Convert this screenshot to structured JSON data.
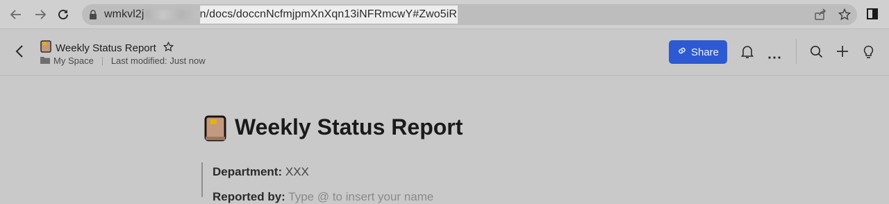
{
  "browser": {
    "url_prefix": "wmkvl2j",
    "url_domain_suffix": "n",
    "url_path": "/docs/doccnNcfmjpmXnXqn13iNFRmcwY#Zwo5iR",
    "icons": [
      "back-arrow-icon",
      "forward-arrow-icon",
      "reload-icon",
      "lock-icon",
      "share-page-icon",
      "bookmark-star-icon",
      "side-panel-icon"
    ]
  },
  "header": {
    "doc_title": "Weekly Status Report",
    "space": "My Space",
    "modified": "Last modified: Just now",
    "share_label": "Share"
  },
  "document": {
    "heading": "Weekly Status Report",
    "fields": [
      {
        "label": "Department:",
        "value": "XXX"
      },
      {
        "label": "Reported by:",
        "value": "Type @ to insert your name"
      }
    ]
  },
  "colors": {
    "accent": "#2d5ad2",
    "book_cover": "#c29a80",
    "book_tab": "#e6b400"
  }
}
